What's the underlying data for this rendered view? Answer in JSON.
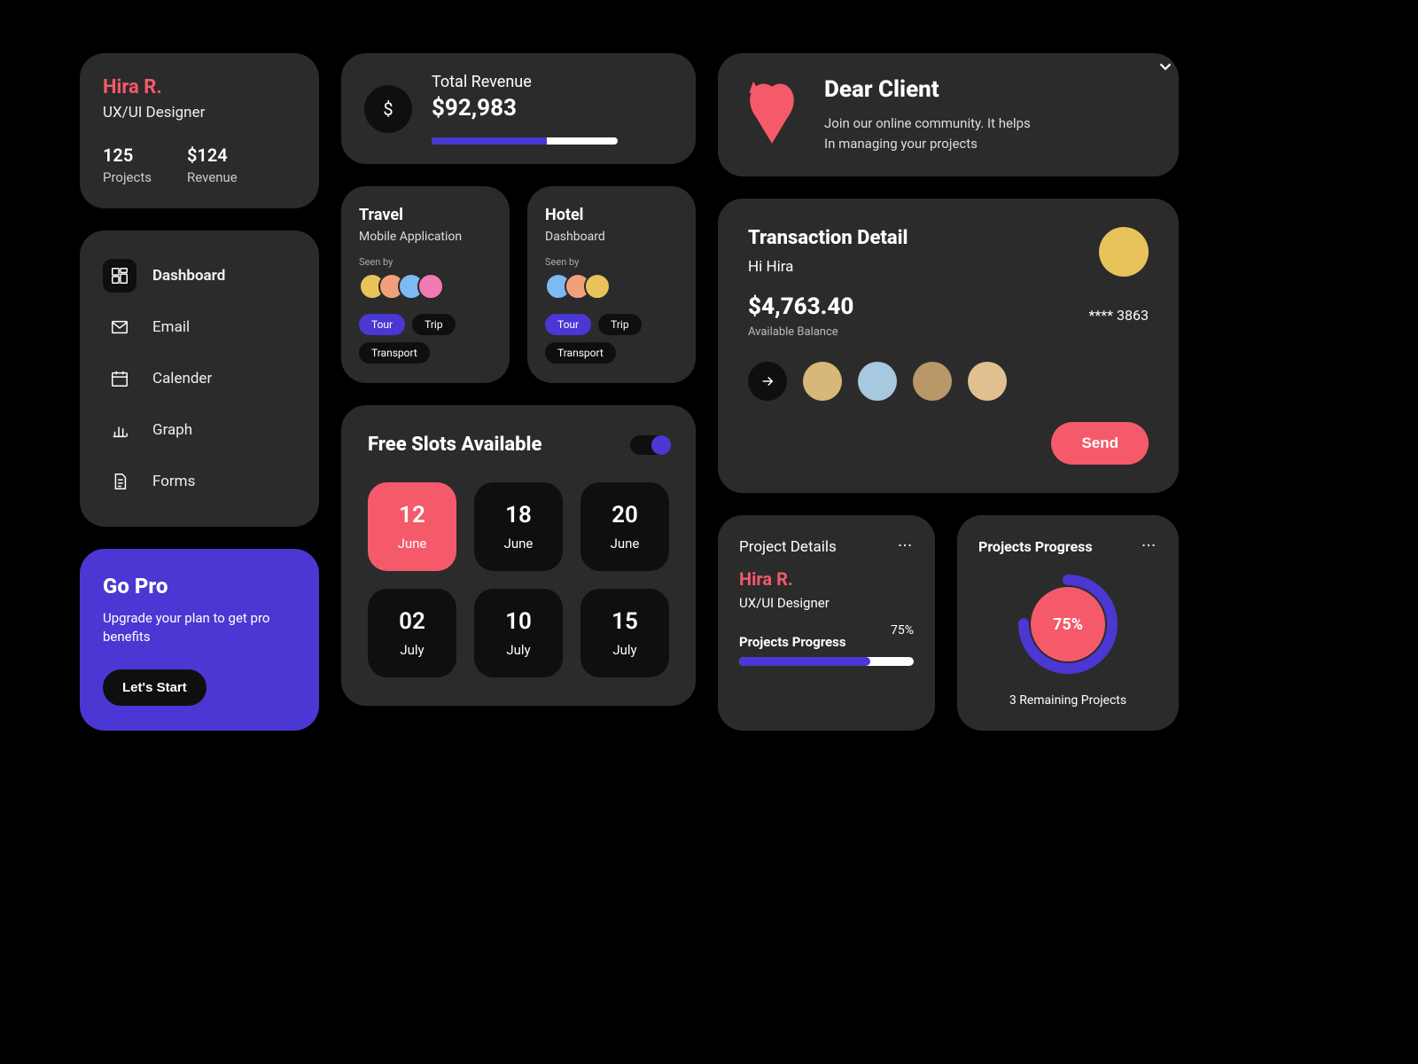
{
  "profile": {
    "name": "Hira R.",
    "role": "UX/UI Designer",
    "projects_value": "125",
    "projects_label": "Projects",
    "revenue_value": "$124",
    "revenue_label": "Revenue"
  },
  "nav": {
    "items": [
      {
        "label": "Dashboard",
        "icon": "dashboard",
        "active": true
      },
      {
        "label": "Email",
        "icon": "mail"
      },
      {
        "label": "Calender",
        "icon": "calendar"
      },
      {
        "label": "Graph",
        "icon": "graph"
      },
      {
        "label": "Forms",
        "icon": "forms"
      }
    ]
  },
  "gopro": {
    "title": "Go Pro",
    "subtitle": "Upgrade your plan to get pro benefits",
    "cta": "Let's Start"
  },
  "revenue": {
    "label": "Total Revenue",
    "value": "$92,983",
    "progress_pct": 62
  },
  "mini": [
    {
      "title": "Travel",
      "subtitle": "Mobile Application",
      "seen_label": "Seen by",
      "tags": [
        "Tour",
        "Trip",
        "Transport"
      ]
    },
    {
      "title": "Hotel",
      "subtitle": "Dashboard",
      "seen_label": "Seen by",
      "tags": [
        "Tour",
        "Trip",
        "Transport"
      ]
    }
  ],
  "slots": {
    "title": "Free Slots Available",
    "items": [
      {
        "day": "12",
        "month": "June",
        "selected": true
      },
      {
        "day": "18",
        "month": "June"
      },
      {
        "day": "20",
        "month": "June"
      },
      {
        "day": "02",
        "month": "July"
      },
      {
        "day": "10",
        "month": "July"
      },
      {
        "day": "15",
        "month": "July"
      }
    ]
  },
  "notice": {
    "title": "Dear Client",
    "line1": "Join our online community. It helps",
    "line2": "In managing your projects"
  },
  "transaction": {
    "title": "Transaction Detail",
    "greeting": "Hi Hira",
    "amount": "$4,763.40",
    "amount_label": "Available Balance",
    "card_mask": "**** 3863",
    "send_label": "Send"
  },
  "project_details": {
    "heading": "Project Details",
    "name": "Hira R.",
    "role": "UX/UI Designer",
    "section": "Projects Progress",
    "pct_label": "75%",
    "pct": 75
  },
  "project_progress": {
    "heading": "Projects Progress",
    "pct_label": "75%",
    "pct": 75,
    "remaining": "3 Remaining Projects"
  }
}
